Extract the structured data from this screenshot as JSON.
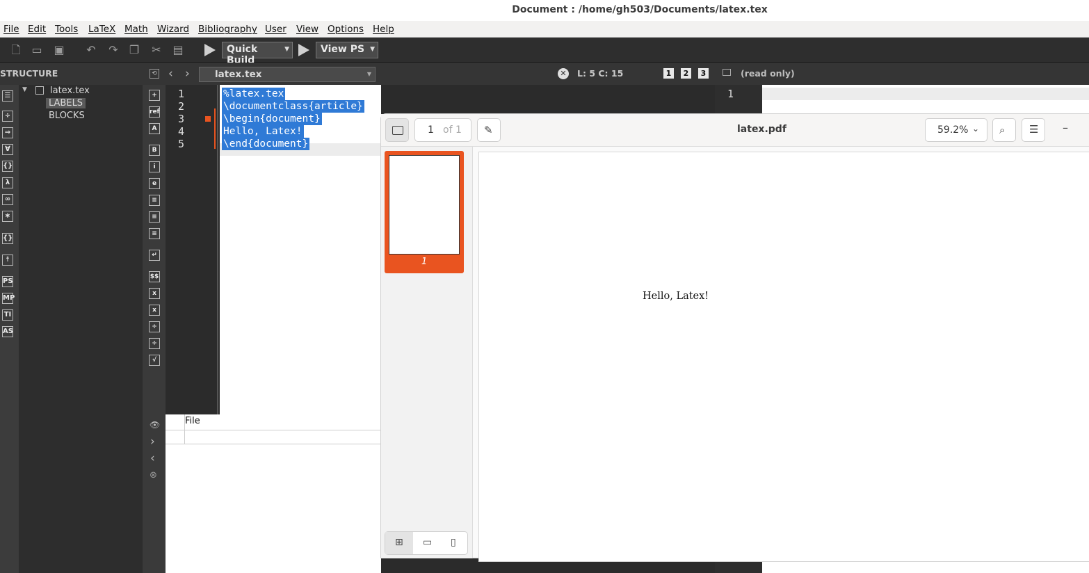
{
  "window": {
    "title": "Document : /home/gh503/Documents/latex.tex"
  },
  "menu": [
    "File",
    "Edit",
    "Tools",
    "LaTeX",
    "Math",
    "Wizard",
    "Bibliography",
    "User",
    "View",
    "Options",
    "Help"
  ],
  "toolbar": {
    "build_label": "Quick Build",
    "view_label": "View PS"
  },
  "structure": {
    "title": "STRUCTURE",
    "root": "latex.tex",
    "items": [
      "LABELS",
      "BLOCKS"
    ]
  },
  "editor": {
    "tab_label": "latex.tex",
    "cursor": "L: 5 C: 15",
    "view_buttons": [
      "1",
      "2",
      "3"
    ],
    "readonly": "(read only)",
    "line_numbers": [
      "1",
      "2",
      "3",
      "4",
      "5"
    ],
    "lines": [
      "%latex.tex",
      "\\documentclass{article}",
      "\\begin{document}",
      "Hello, Latex!",
      "\\end{document}"
    ],
    "right_line_number": "1"
  },
  "log": {
    "column_header": "File"
  },
  "pdf": {
    "page_input": "1",
    "page_of": "of 1",
    "filename": "latex.pdf",
    "zoom": "59.2%",
    "thumb_label": "1",
    "content": "Hello, Latex!",
    "minimize": "–"
  },
  "colors": {
    "accent": "#e95420",
    "selection": "#2f7ad6"
  }
}
